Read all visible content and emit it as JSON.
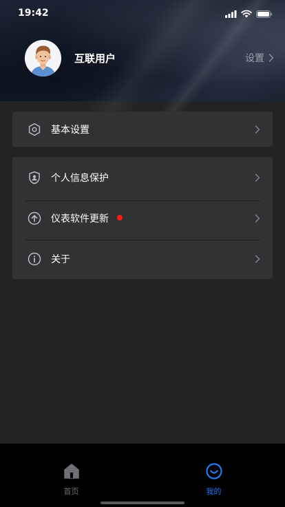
{
  "status_bar": {
    "time": "19:42",
    "icons": [
      "signal-icon",
      "wifi-icon",
      "battery-icon"
    ]
  },
  "profile": {
    "user_name": "互联用户",
    "settings_label": "设置",
    "avatar_icon": "user-avatar"
  },
  "menu_groups": [
    {
      "items": [
        {
          "label": "基本设置",
          "icon": "hexagon-gear-icon"
        }
      ]
    },
    {
      "items": [
        {
          "label": "个人信息保护",
          "icon": "shield-user-icon"
        },
        {
          "label": "仪表软件更新",
          "icon": "upload-arrow-icon",
          "badge": true
        },
        {
          "label": "关于",
          "icon": "info-icon"
        }
      ]
    }
  ],
  "tabbar": {
    "tabs": [
      {
        "label": "首页",
        "icon": "home-icon",
        "active": false
      },
      {
        "label": "我的",
        "icon": "smile-icon",
        "active": true
      }
    ]
  },
  "colors": {
    "accent": "#1e7bf2",
    "badge": "#ff1a1a",
    "background": "#232325",
    "card": "#323234"
  }
}
